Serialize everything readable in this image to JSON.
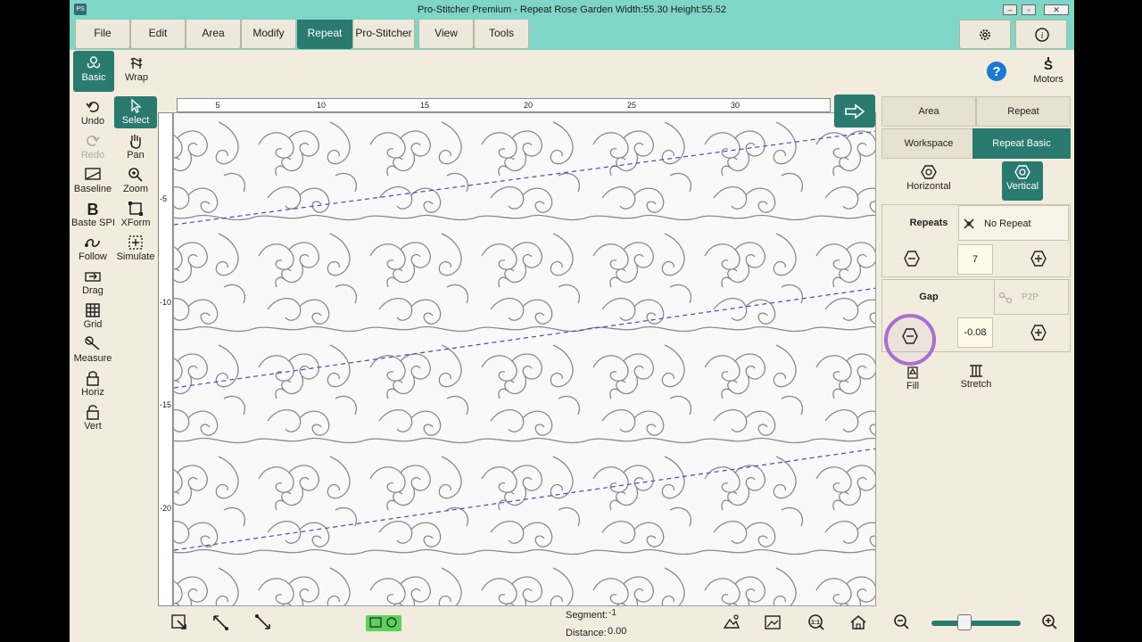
{
  "window": {
    "title": "Pro-Stitcher Premium   -   Repeat Rose Garden   Width:55.30   Height:55.52",
    "app_icon": "PS"
  },
  "menu": {
    "tabs": [
      {
        "label": "File"
      },
      {
        "label": "Edit"
      },
      {
        "label": "Area"
      },
      {
        "label": "Modify"
      },
      {
        "label": "Repeat"
      },
      {
        "label": "Pro-Stitcher"
      },
      {
        "label": "View"
      },
      {
        "label": "Tools"
      }
    ],
    "active": "Repeat"
  },
  "mode": {
    "basic": "Basic",
    "wrap": "Wrap"
  },
  "help": {
    "motors": "Motors"
  },
  "toolbar": {
    "undo": "Undo",
    "select": "Select",
    "redo": "Redo",
    "pan": "Pan",
    "baseline": "Baseline",
    "zoom": "Zoom",
    "baste_spi": "Baste SPI",
    "xform": "XForm",
    "follow": "Follow",
    "simulate": "Simulate",
    "drag": "Drag",
    "grid": "Grid",
    "measure": "Measure",
    "horiz": "Horiz",
    "vert": "Vert"
  },
  "ruler": {
    "h_ticks": [
      "5",
      "10",
      "15",
      "20",
      "25",
      "30"
    ],
    "v_ticks": [
      "-5",
      "-10",
      "-15",
      "-20"
    ]
  },
  "right_panel": {
    "tabs_row1": [
      "Area",
      "Repeat"
    ],
    "tabs_row2": [
      "Workspace",
      "Repeat Basic"
    ],
    "active_tab": "Repeat Basic",
    "horizontal": "Horizontal",
    "vertical": "Vertical",
    "repeats_label": "Repeats",
    "no_repeat": "No Repeat",
    "repeats_value": "7",
    "gap_label": "Gap",
    "p2p": "P2P",
    "gap_value": "-0.08",
    "fill": "Fill",
    "stretch": "Stretch"
  },
  "status": {
    "segment_label": "Segment:",
    "segment_value": "-1",
    "distance_label": "Distance:",
    "distance_value": "0.00"
  },
  "colors": {
    "accent": "#2a7a70",
    "title_bar": "#7fd6c6",
    "highlight_ring": "#a86fd0",
    "dash_line": "#4a4ab8"
  }
}
